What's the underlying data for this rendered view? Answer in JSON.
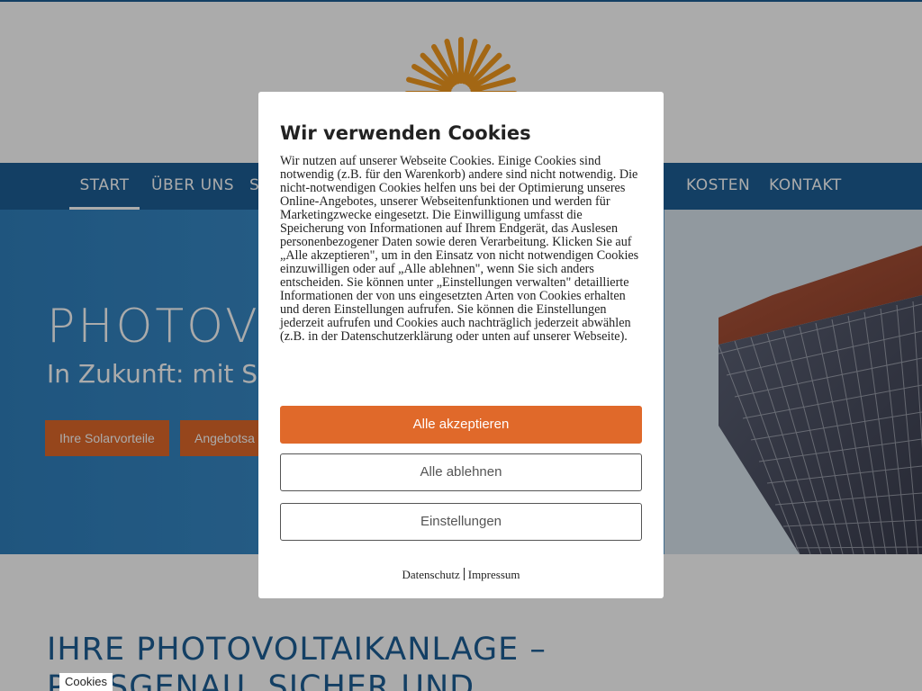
{
  "nav": {
    "items": [
      {
        "label": "START",
        "active": true
      },
      {
        "label": "ÜBER UNS",
        "active": false
      },
      {
        "label": "S",
        "active": false
      },
      {
        "label": "KOSTEN",
        "active": false
      },
      {
        "label": "KONTAKT",
        "active": false
      }
    ]
  },
  "hero": {
    "title": "PHOTOV",
    "subtitle": "In Zukunft: mit So",
    "buttons": [
      "Ihre Solarvorteile",
      "Angebotsa"
    ]
  },
  "section": {
    "title_line1": "IHRE PHOTOVOLTAIKANLAGE –",
    "title_line2": "PASSGENAU, SICHER UND"
  },
  "cookie_tab": {
    "label": "Cookies"
  },
  "cookie_modal": {
    "title": "Wir verwenden Cookies",
    "body": "Wir nutzen auf unserer Webseite Cookies. Einige Cookies sind notwendig (z.B. für den Warenkorb) andere sind nicht notwendig. Die nicht-notwendigen Cookies helfen uns bei der Optimierung unseres Online-Angebotes, unserer Webseitenfunktionen und werden für Marketingzwecke eingesetzt. Die Einwilligung umfasst die Speicherung von Informationen auf Ihrem Endgerät, das Auslesen personenbezogener Daten sowie deren Verarbeitung. Klicken Sie auf „Alle akzeptieren\", um in den Einsatz von nicht notwendigen Cookies einzuwilligen oder auf „Alle ablehnen\", wenn Sie sich anders entscheiden. Sie können unter „Einstellungen verwalten\" detaillierte Informationen der von uns eingesetzten Arten von Cookies erhalten und deren Einstellungen aufrufen. Sie können die Einstellungen jederzeit aufrufen und Cookies auch nachträglich jederzeit abwählen (z.B. in der Datenschutzerklärung oder unten auf unserer Webseite).",
    "accept_label": "Alle akzeptieren",
    "reject_label": "Alle ablehnen",
    "settings_label": "Einstellungen",
    "privacy_link": "Datenschutz",
    "imprint_link": "Impressum"
  },
  "colors": {
    "brand_blue": "#1d5f95",
    "accent_orange": "#e0692a",
    "logo_orange": "#f39a1e"
  },
  "icons": [
    "sun-logo-icon",
    "solar-panel-image"
  ]
}
